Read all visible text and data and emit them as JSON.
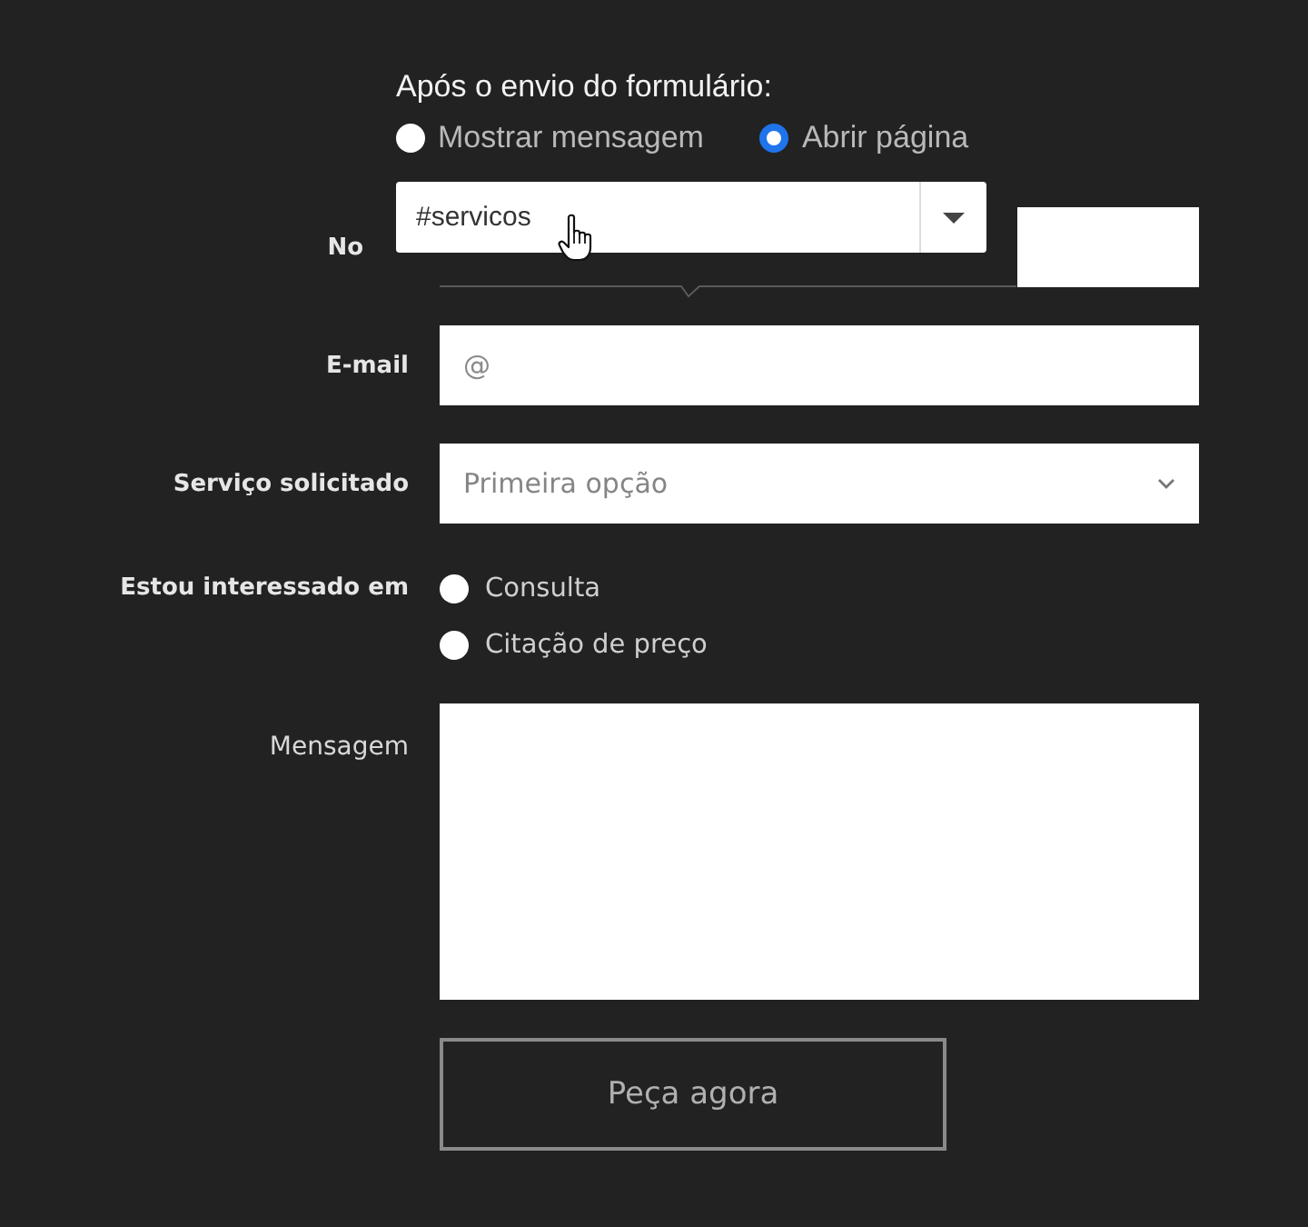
{
  "popover": {
    "title": "Após o envio do formulário:",
    "options": [
      {
        "label": "Mostrar mensagem",
        "selected": false
      },
      {
        "label": "Abrir página",
        "selected": true
      }
    ],
    "page_select": {
      "value": "#servicos"
    }
  },
  "form": {
    "fields": [
      {
        "kind": "text",
        "label": "No",
        "bold": true
      },
      {
        "kind": "text",
        "label": "E-mail",
        "bold": true,
        "placeholder": "@"
      },
      {
        "kind": "select",
        "label": "Serviço solicitado",
        "bold": true,
        "placeholder": "Primeira opção"
      },
      {
        "kind": "radio",
        "label": "Estou interessado em",
        "bold": true,
        "options": [
          {
            "label": "Consulta",
            "selected": false
          },
          {
            "label": "Citação de preço",
            "selected": false
          }
        ]
      },
      {
        "kind": "textarea",
        "label": "Mensagem",
        "bold": false
      }
    ],
    "submit": "Peça agora"
  }
}
